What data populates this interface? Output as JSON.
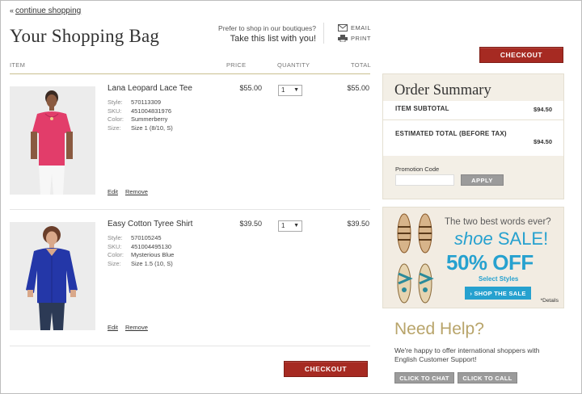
{
  "nav": {
    "continue_arrow": "«",
    "continue_label": "continue shopping"
  },
  "page": {
    "title": "Your Shopping Bag"
  },
  "boutique": {
    "question": "Prefer to shop in our boutiques?",
    "tagline": "Take this list with you!"
  },
  "share": {
    "email": "EMAIL",
    "print": "PRINT"
  },
  "buttons": {
    "checkout": "CHECKOUT",
    "apply": "APPLY",
    "chat": "CLICK TO CHAT",
    "call": "CLICK TO CALL"
  },
  "table": {
    "headers": {
      "item": "ITEM",
      "price": "PRICE",
      "quantity": "QUANTITY",
      "total": "TOTAL"
    }
  },
  "items": [
    {
      "name": "Lana Leopard Lace Tee",
      "style": "570113309",
      "sku": "451004831976",
      "color": "Summerberry",
      "size": "Size 1 (8/10, S)",
      "price": "$55.00",
      "qty": "1",
      "total": "$55.00"
    },
    {
      "name": "Easy Cotton Tyree Shirt",
      "style": "570105245",
      "sku": "451004495130",
      "color": "Mysterious Blue",
      "size": "Size 1.5 (10, S)",
      "price": "$39.50",
      "qty": "1",
      "total": "$39.50"
    }
  ],
  "meta_labels": {
    "style": "Style:",
    "sku": "SKU:",
    "color": "Color:",
    "size": "Size:"
  },
  "item_actions": {
    "edit": "Edit",
    "remove": "Remove"
  },
  "summary": {
    "title": "Order Summary",
    "subtotal_label": "ITEM SUBTOTAL",
    "subtotal_value": "$94.50",
    "estimated_label": "ESTIMATED TOTAL (BEFORE TAX)",
    "estimated_value": "$94.50",
    "promo_label": "Promotion Code",
    "promo_value": ""
  },
  "banner": {
    "line1": "The two best words ever?",
    "line2_a": "shoe",
    "line2_b": "SALE!",
    "line3": "50% OFF",
    "line4": "Select Styles",
    "cta": "› SHOP THE SALE",
    "details": "*Details"
  },
  "help": {
    "title": "Need Help?",
    "text": "We're happy to offer international shoppers with English Customer Support!"
  },
  "colors": {
    "accent_red": "#a62a22",
    "gold": "#b8a46a",
    "promo_blue": "#26a1cf"
  }
}
